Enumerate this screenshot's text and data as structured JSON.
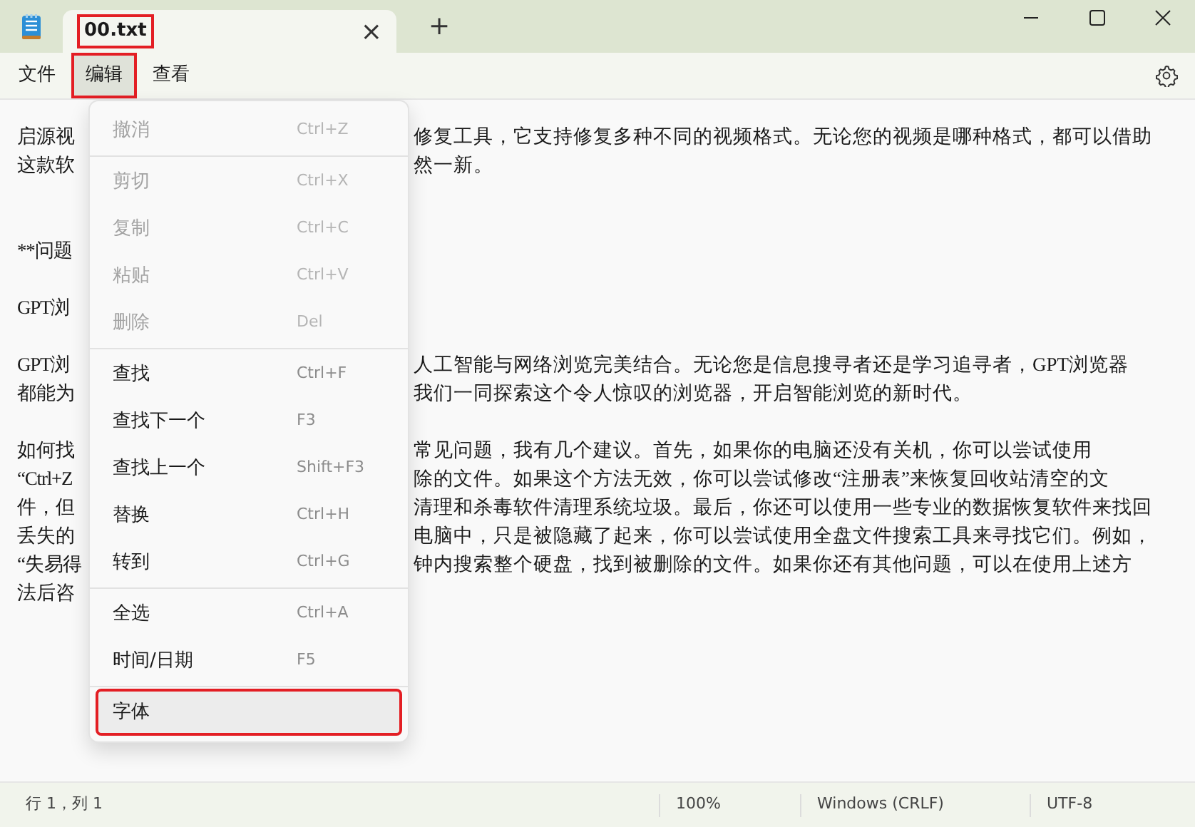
{
  "tab": {
    "title": "00.txt",
    "selected": true,
    "highlighted": true,
    "close": "×"
  },
  "new_tab": "+",
  "menubar": [
    {
      "label": "文件",
      "selected": false,
      "highlighted": false
    },
    {
      "label": "编辑",
      "selected": true,
      "highlighted": true
    },
    {
      "label": "查看",
      "selected": false,
      "highlighted": false
    }
  ],
  "document": [
    {
      "left": "启源视",
      "right": "修复工具，它支持修复多种不同的视频格式。无论您的视频是哪种格式，都可以借助"
    },
    {
      "left": "这款软",
      "right": "然一新。"
    },
    {
      "kind": "blank"
    },
    {
      "kind": "blank"
    },
    {
      "left": "**问题"
    },
    {
      "kind": "blank"
    },
    {
      "left": "GPT浏"
    },
    {
      "kind": "blank"
    },
    {
      "left": "GPT浏",
      "right": "人工智能与网络浏览完美结合。无论您是信息搜寻者还是学习追寻者，GPT浏览器"
    },
    {
      "left": "都能为",
      "right": "我们一同探索这个令人惊叹的浏览器，开启智能浏览的新时代。"
    },
    {
      "kind": "blank"
    },
    {
      "left": "如何找",
      "right": "常见问题，我有几个建议。首先，如果你的电脑还没有关机，你可以尝试使用"
    },
    {
      "left": "“Ctrl+Z",
      "right": "除的文件。如果这个方法无效，你可以尝试修改“注册表”来恢复回收站清空的文"
    },
    {
      "left": "件，但",
      "right": "清理和杀毒软件清理系统垃圾。最后，你还可以使用一些专业的数据恢复软件来找回"
    },
    {
      "left": "丢失的",
      "right": "电脑中，只是被隐藏了起来，你可以尝试使用全盘文件搜索工具来寻找它们。例如，"
    },
    {
      "left": "“失易得",
      "right": "钟内搜索整个硬盘，找到被删除的文件。如果你还有其他问题，可以在使用上述方"
    },
    {
      "left": "法后咨"
    }
  ],
  "edit_menu": [
    {
      "label": "撤消",
      "shortcut": "Ctrl+Z",
      "disabled": true,
      "selected": false,
      "highlighted": false,
      "separator_after": true
    },
    {
      "label": "剪切",
      "shortcut": "Ctrl+X",
      "disabled": true,
      "selected": false,
      "highlighted": false,
      "separator_after": false
    },
    {
      "label": "复制",
      "shortcut": "Ctrl+C",
      "disabled": true,
      "selected": false,
      "highlighted": false,
      "separator_after": false
    },
    {
      "label": "粘贴",
      "shortcut": "Ctrl+V",
      "disabled": true,
      "selected": false,
      "highlighted": false,
      "separator_after": false
    },
    {
      "label": "删除",
      "shortcut": "Del",
      "disabled": true,
      "selected": false,
      "highlighted": false,
      "separator_after": true
    },
    {
      "label": "查找",
      "shortcut": "Ctrl+F",
      "disabled": false,
      "selected": false,
      "highlighted": false,
      "separator_after": false
    },
    {
      "label": "查找下一个",
      "shortcut": "F3",
      "disabled": false,
      "selected": false,
      "highlighted": false,
      "separator_after": false
    },
    {
      "label": "查找上一个",
      "shortcut": "Shift+F3",
      "disabled": false,
      "selected": false,
      "highlighted": false,
      "separator_after": false
    },
    {
      "label": "替换",
      "shortcut": "Ctrl+H",
      "disabled": false,
      "selected": false,
      "highlighted": false,
      "separator_after": false
    },
    {
      "label": "转到",
      "shortcut": "Ctrl+G",
      "disabled": false,
      "selected": false,
      "highlighted": false,
      "separator_after": true
    },
    {
      "label": "全选",
      "shortcut": "Ctrl+A",
      "disabled": false,
      "selected": false,
      "highlighted": false,
      "separator_after": false
    },
    {
      "label": "时间/日期",
      "shortcut": "F5",
      "disabled": false,
      "selected": false,
      "highlighted": false,
      "separator_after": true
    },
    {
      "label": "字体",
      "disabled": false,
      "selected": true,
      "highlighted": true,
      "separator_after": false
    }
  ],
  "status_bar": {
    "position": "行 1，列 1",
    "zoom": "100%",
    "line_ending": "Windows (CRLF)",
    "encoding": "UTF-8"
  }
}
